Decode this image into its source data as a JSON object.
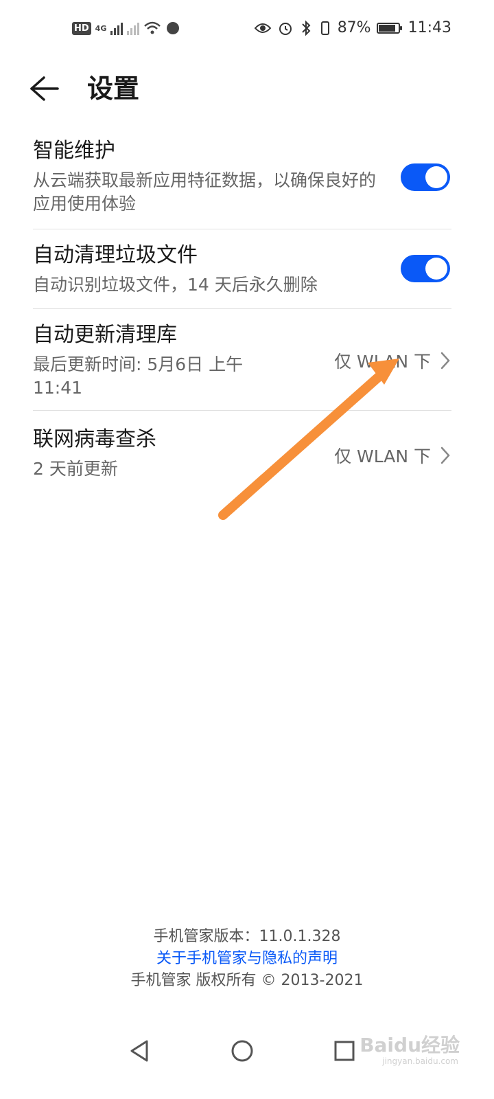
{
  "status_bar": {
    "left_badge": "HD",
    "network_label": "4G",
    "battery_percent": "87%",
    "battery_level": 0.87,
    "time": "11:43"
  },
  "header": {
    "title": "设置"
  },
  "settings": [
    {
      "title": "智能维护",
      "description": "从云端获取最新应用特征数据，以确保良好的应用使用体验",
      "toggle_on": true
    },
    {
      "title": "自动清理垃圾文件",
      "description": "自动识别垃圾文件，14 天后永久删除",
      "toggle_on": true
    },
    {
      "title": "自动更新清理库",
      "description": "最后更新时间: 5月6日 上午11:41",
      "value": "仅 WLAN 下"
    },
    {
      "title": "联网病毒查杀",
      "description": "2 天前更新",
      "value": "仅 WLAN 下"
    }
  ],
  "footer": {
    "version": "手机管家版本：11.0.1.328",
    "privacy_link": "关于手机管家与隐私的声明",
    "copyright": "手机管家 版权所有 © 2013-2021"
  },
  "watermark": {
    "brand": "Baidu经验",
    "url": "jingyan.baidu.com"
  },
  "colors": {
    "accent": "#0a59f7",
    "annotation_arrow": "#f7903a"
  },
  "icons": [
    "back-arrow-icon",
    "chevron-right-icon",
    "nav-back-icon",
    "nav-home-icon",
    "nav-recent-icon"
  ]
}
